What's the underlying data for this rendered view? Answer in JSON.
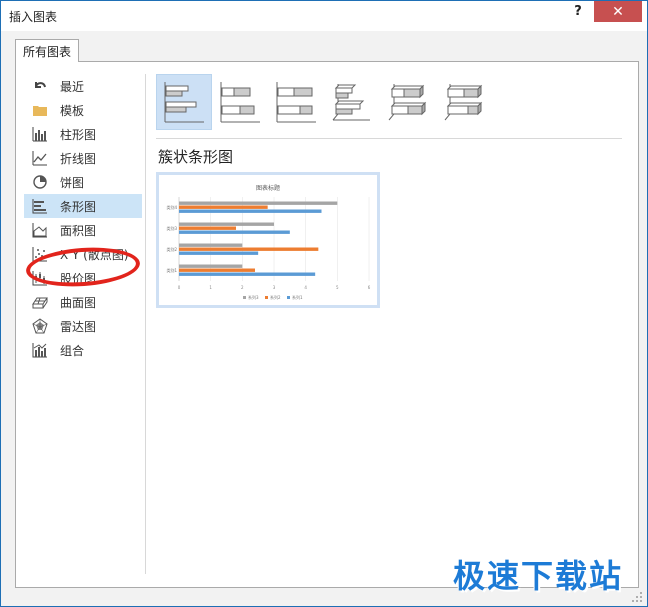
{
  "window": {
    "title": "插入图表",
    "help": "?",
    "close": "✕"
  },
  "tab": {
    "label": "所有图表"
  },
  "sidebar": {
    "items": [
      {
        "label": "最近",
        "icon": "undo-arrow-icon"
      },
      {
        "label": "模板",
        "icon": "folder-icon"
      },
      {
        "label": "柱形图",
        "icon": "column-chart-icon"
      },
      {
        "label": "折线图",
        "icon": "line-chart-icon"
      },
      {
        "label": "饼图",
        "icon": "pie-chart-icon"
      },
      {
        "label": "条形图",
        "icon": "bar-chart-icon",
        "selected": true
      },
      {
        "label": "面积图",
        "icon": "area-chart-icon"
      },
      {
        "label": "X Y (散点图)",
        "icon": "scatter-chart-icon"
      },
      {
        "label": "股价图",
        "icon": "stock-chart-icon"
      },
      {
        "label": "曲面图",
        "icon": "surface-chart-icon"
      },
      {
        "label": "雷达图",
        "icon": "radar-chart-icon"
      },
      {
        "label": "组合",
        "icon": "combo-chart-icon"
      }
    ]
  },
  "subtypes": {
    "items": [
      "clustered-bar-icon",
      "stacked-bar-icon",
      "percent-stacked-bar-icon",
      "3d-clustered-bar-icon",
      "3d-stacked-bar-icon",
      "3d-percent-stacked-bar-icon"
    ],
    "selected_index": 0
  },
  "main": {
    "chart_type_title": "簇状条形图"
  },
  "chart_data": {
    "type": "bar",
    "title": "图表标题",
    "categories": [
      "类别1",
      "类别2",
      "类别3",
      "类别4"
    ],
    "series": [
      {
        "name": "系列1",
        "values": [
          4.3,
          2.5,
          3.5,
          4.5
        ],
        "color": "#5b9bd5"
      },
      {
        "name": "系列2",
        "values": [
          2.4,
          4.4,
          1.8,
          2.8
        ],
        "color": "#ed7d31"
      },
      {
        "name": "系列3",
        "values": [
          2,
          2,
          3,
          5
        ],
        "color": "#a5a5a5"
      }
    ],
    "xlim": [
      0,
      6
    ],
    "x_ticks": [
      "0",
      "1",
      "2",
      "3",
      "4",
      "5",
      "6"
    ],
    "legend": "bottom",
    "grid": true
  },
  "watermark": {
    "text": "极速下载站"
  },
  "colors": {
    "selection": "#cce4f7",
    "close_button": "#c75050",
    "annotation_circle": "#e2241c",
    "watermark": "#1d7bd6"
  }
}
